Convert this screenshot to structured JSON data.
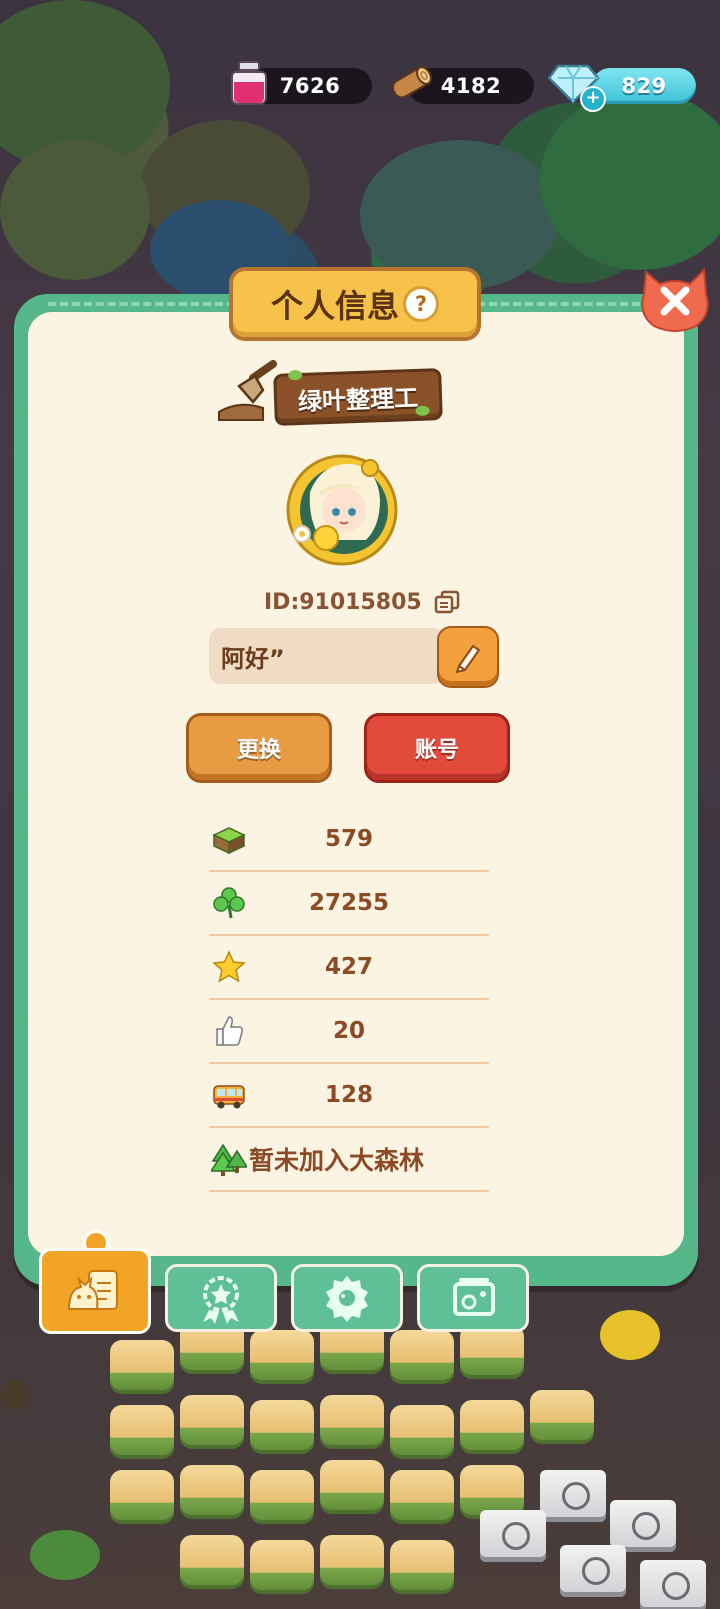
{
  "resources": {
    "potion": {
      "value": "7626",
      "icon": "potion-jar-icon"
    },
    "wood": {
      "value": "4182",
      "icon": "wood-log-icon"
    },
    "gem": {
      "value": "829",
      "icon": "diamond-icon"
    }
  },
  "panel": {
    "title": "个人信息",
    "help_label": "?",
    "rank_title": "绿叶整理工"
  },
  "profile": {
    "id_text": "ID:91015805",
    "nickname": "阿好”",
    "change_button": "更换",
    "account_button": "账号"
  },
  "stats": [
    {
      "icon": "grass-block-icon",
      "value": "579"
    },
    {
      "icon": "clover-icon",
      "value": "27255"
    },
    {
      "icon": "star-icon",
      "value": "427"
    },
    {
      "icon": "thumbs-up-icon",
      "value": "20"
    },
    {
      "icon": "bus-icon",
      "value": "128"
    },
    {
      "icon": "forest-icon",
      "value": "暂未加入大森林"
    }
  ],
  "tabs": [
    {
      "icon": "profile-card-icon",
      "active": true
    },
    {
      "icon": "flower-badge-icon",
      "active": false
    },
    {
      "icon": "settings-gear-icon",
      "active": false
    },
    {
      "icon": "photo-album-icon",
      "active": false
    }
  ],
  "colors": {
    "panel_border": "#56b88a",
    "panel_bg": "#fbf4e3",
    "title_plate": "#f6c24a",
    "change_button": "#e79b42",
    "account_button": "#e24a3c",
    "stat_text": "#8a4b26",
    "close_button": "#f06a4d"
  }
}
